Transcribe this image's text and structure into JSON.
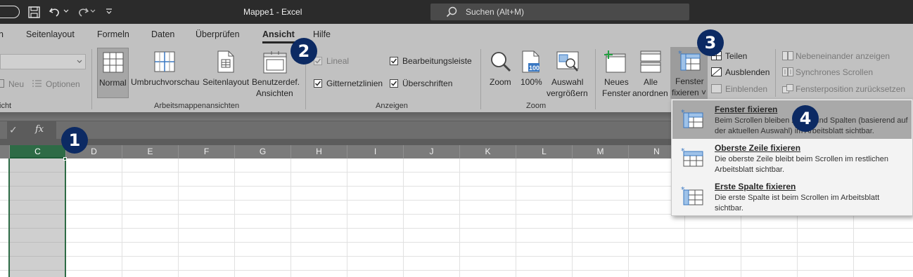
{
  "titlebar": {
    "doc_title": "Mappe1  -  Excel",
    "search_placeholder": "Suchen (Alt+M)"
  },
  "tabs": [
    {
      "label": "n"
    },
    {
      "label": "Seitenlayout"
    },
    {
      "label": "Formeln"
    },
    {
      "label": "Daten"
    },
    {
      "label": "Überprüfen"
    },
    {
      "label": "Ansicht",
      "active": true
    },
    {
      "label": "Hilfe"
    }
  ],
  "ribbon": {
    "sheetview": {
      "new_label": "Neu",
      "options_label": "Optionen",
      "group_partial": "icht"
    },
    "workbook_views": {
      "group_label": "Arbeitsmappenansichten",
      "buttons": [
        {
          "label": "Normal",
          "selected": true
        },
        {
          "label": "Umbruchvorschau"
        },
        {
          "label": "Seitenlayout"
        },
        {
          "label": "Benutzerdef.",
          "label2": "Ansichten"
        }
      ]
    },
    "show": {
      "group_label": "Anzeigen",
      "checkboxes": [
        {
          "label": "Lineal",
          "checked": true,
          "disabled": true
        },
        {
          "label": "Bearbeitungsleiste",
          "checked": true
        },
        {
          "label": "Gitternetzlinien",
          "checked": true
        },
        {
          "label": "Überschriften",
          "checked": true
        }
      ]
    },
    "zoom": {
      "group_label": "Zoom",
      "buttons": [
        {
          "label": "Zoom"
        },
        {
          "label": "100%",
          "icon_text": "100"
        },
        {
          "label": "Auswahl",
          "label2": "vergrößern"
        }
      ]
    },
    "window": {
      "new_window": {
        "label": "Neues",
        "label2": "Fenster"
      },
      "arrange_all": {
        "label": "Alle",
        "label2": "anordnen"
      },
      "freeze": {
        "label": "Fenster",
        "label2": "fixieren ˅"
      },
      "small": [
        {
          "label": "Teilen"
        },
        {
          "label": "Ausblenden"
        },
        {
          "label": "Einblenden",
          "disabled": true
        }
      ],
      "compare": [
        {
          "label": "Nebeneinander anzeigen",
          "disabled": true
        },
        {
          "label": "Synchrones Scrollen",
          "disabled": true
        },
        {
          "label": "Fensterposition zurücksetzen",
          "disabled": true
        }
      ]
    }
  },
  "formula_bar": {
    "fx_label": "fx",
    "check_label": "✓"
  },
  "columns": [
    "C",
    "D",
    "E",
    "F",
    "G",
    "H",
    "I",
    "J",
    "K",
    "L",
    "M",
    "N"
  ],
  "dropdown": {
    "items": [
      {
        "title": "Fenster fixieren",
        "desc": "Beim Scrollen bleiben Zeilen und Spalten (basierend auf der aktuellen Auswahl) im Arbeitsblatt sichtbar.",
        "selected": true
      },
      {
        "title": "Oberste Zeile fixieren",
        "desc": "Die oberste Zeile bleibt beim Scrollen im restlichen Arbeitsblatt sichtbar."
      },
      {
        "title": "Erste Spalte fixieren",
        "desc": "Die erste Spalte ist beim Scrollen im Arbeitsblatt sichtbar."
      }
    ]
  },
  "markers": [
    "1",
    "2",
    "3",
    "4"
  ],
  "colors": {
    "titlebar": "#2b2b2b",
    "ribbon": "#c1c1c1",
    "selected_column": "#2e6b46",
    "marker": "#0c2a63",
    "freeze_icon_blue": "#3a78c2"
  }
}
